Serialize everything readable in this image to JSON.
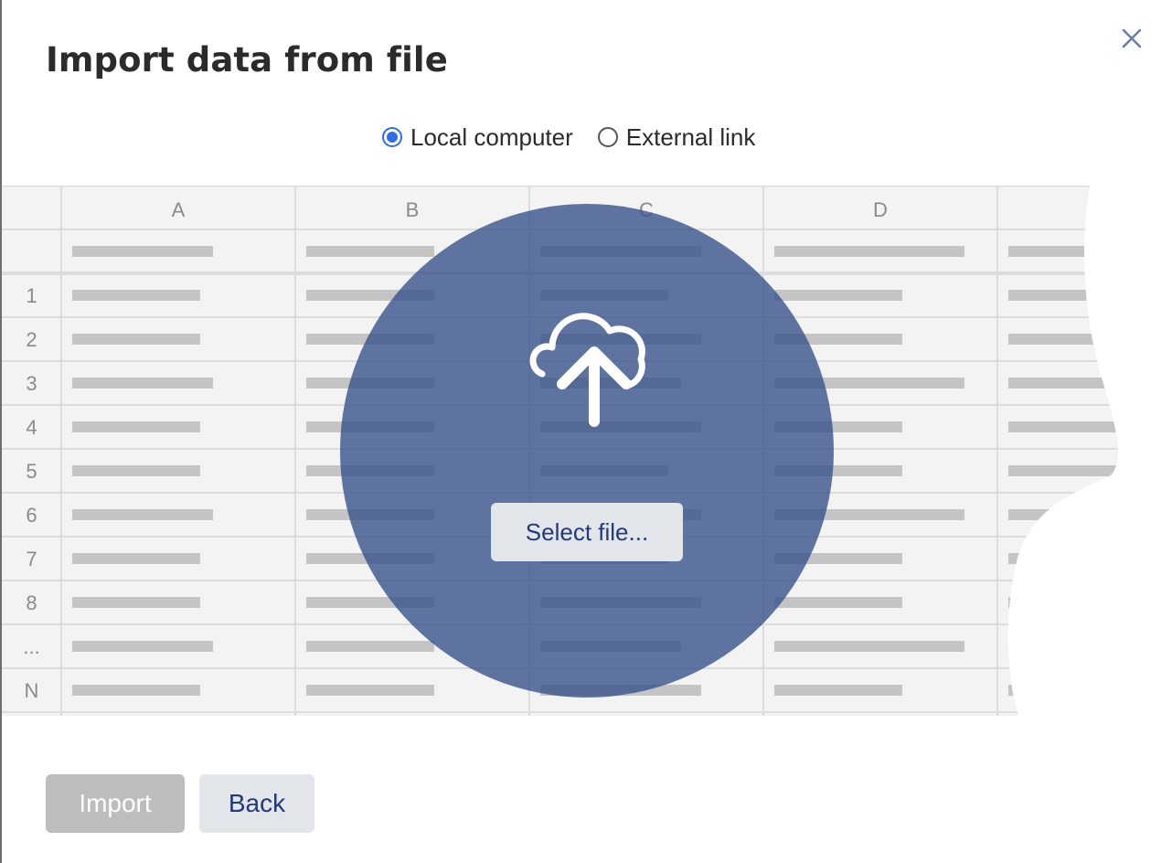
{
  "dialog": {
    "title": "Import data from file",
    "close_icon": "close-icon"
  },
  "source": {
    "options": [
      {
        "label": "Local computer",
        "selected": true
      },
      {
        "label": "External link",
        "selected": false
      }
    ]
  },
  "preview": {
    "columns": [
      "A",
      "B",
      "C",
      "D"
    ],
    "rows": [
      "1",
      "2",
      "3",
      "4",
      "5",
      "6",
      "7",
      "8",
      "...",
      "N"
    ]
  },
  "upload": {
    "icon": "cloud-upload-icon",
    "select_label": "Select file..."
  },
  "footer": {
    "import_label": "Import",
    "back_label": "Back"
  },
  "colors": {
    "overlay": "#39528c",
    "accent": "#2f6fe4",
    "button_text": "#23397a",
    "disabled_button": "#bdbdbd"
  }
}
